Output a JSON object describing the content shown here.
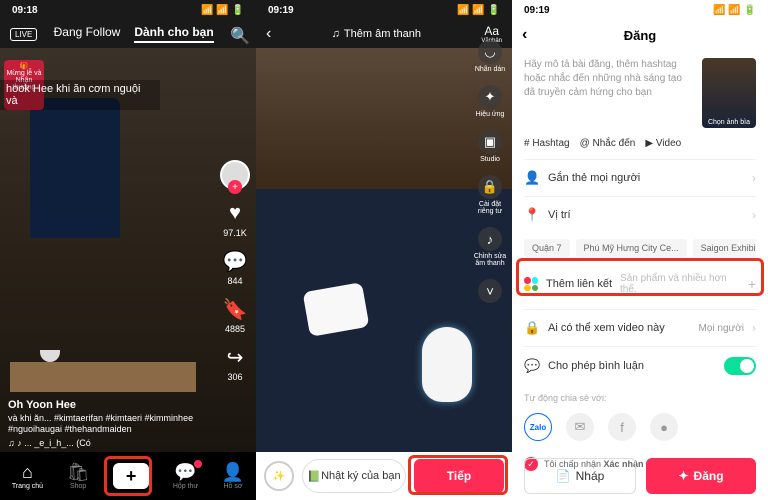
{
  "status": {
    "time1": "09:18",
    "time2": "09:19",
    "time3": "09:19"
  },
  "s1": {
    "live": "LIVE",
    "tab_following": "Đang Follow",
    "tab_foryou": "Dành cho bạn",
    "gift_line1": "Mừng lễ và",
    "gift_line2": "Nhận thưởng",
    "caption": "hook Hee khi ăn cơm nguội và",
    "likes": "97.1K",
    "comments": "844",
    "saves": "4885",
    "shares": "306",
    "username": "Oh Yoon Hee",
    "desc": "và khi ăn... #kimtaerifan #kimtaeri #kimminhee #nguoihaugai #thehandmaiden",
    "music": "♫ ♪ ... _e_i_h_... (Có",
    "nav": {
      "home": "Trang chủ",
      "shop": "Shop",
      "inbox": "Hộp thư",
      "profile": "Hồ sơ"
    }
  },
  "s2": {
    "title": "Thêm âm thanh",
    "aa": "Aa",
    "aa_sub": "Vănbản",
    "side": {
      "sticker": "Nhãn dán",
      "effect": "Hiệu ứng",
      "studio": "Studio",
      "privacy": "Cài đặt riêng tư",
      "trim": "Chỉnh sửa âm thanh"
    },
    "diary": "Nhật ký của bạn",
    "next": "Tiếp"
  },
  "s3": {
    "title": "Đăng",
    "desc_placeholder": "Hãy mô tả bài đăng, thêm hashtag hoặc nhắc đến những nhà sáng tạo đã truyền cảm hứng cho bạn",
    "thumb_label": "Chọn ảnh bìa",
    "tags": {
      "hashtag": "# Hashtag",
      "mention": "@ Nhắc đến",
      "video": "▶ Video"
    },
    "tag_people": "Gắn thẻ mọi người",
    "location": "Vị trí",
    "locs": [
      "Quận 7",
      "Phú Mỹ Hưng City Ce...",
      "Saigon Exhibition and..."
    ],
    "link_label": "Thêm liên kết",
    "link_sub": "Sản phẩm và nhiều hơn thế.",
    "privacy_label": "Ai có thể xem video này",
    "privacy_val": "Mọi người",
    "comments_label": "Cho phép bình luận",
    "share_label": "Tự động chia sẻ với:",
    "zalo": "Zalo",
    "accept_prefix": "Tôi chấp nhận ",
    "accept_bold": "Xác nhận Sử dụng Nhạc",
    "draft": "Nháp",
    "post": "Đăng"
  }
}
